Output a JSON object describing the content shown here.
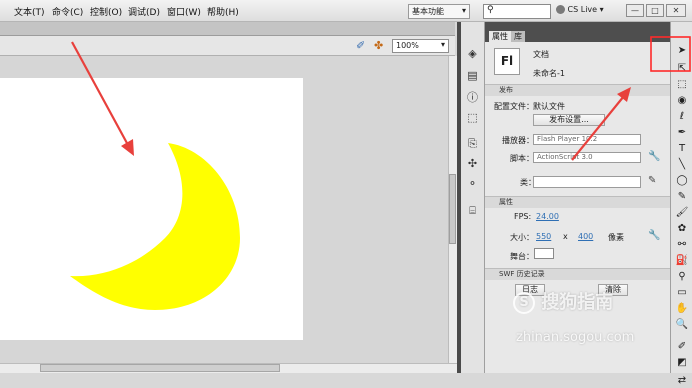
{
  "menu": [
    "文本(T)",
    "命令(C)",
    "控制(O)",
    "调试(D)",
    "窗口(W)",
    "帮助(H)"
  ],
  "workspace": "基本功能",
  "cs_live": "CS Live",
  "window_buttons": [
    "—",
    "□",
    "✕"
  ],
  "zoom": "100%",
  "panel_tabs": {
    "properties": "属性",
    "library": "库"
  },
  "document": {
    "badge": "Fl",
    "type_label": "文档",
    "name": "未命名-1"
  },
  "publish": {
    "section": "发布",
    "profile_label": "配置文件：",
    "profile_value": "默认文件",
    "settings_button": "发布设置...",
    "player_label": "播放器：",
    "player_value": "Flash Player 10.2",
    "script_label": "脚本：",
    "script_value": "ActionScript 3.0",
    "class_label": "类："
  },
  "attributes": {
    "section": "属性",
    "fps_label": "FPS:",
    "fps_value": "24.00",
    "size_label": "大小：",
    "width": "550",
    "x": "x",
    "height": "400",
    "unit": "像素",
    "stage_label": "舞台："
  },
  "swf_history": {
    "section": "SWF 历史记录",
    "btn_log": "日志",
    "btn_clear": "清除"
  },
  "watermark": {
    "brand": "搜狗指南",
    "url": "zhinan.sogou.com"
  },
  "colors": {
    "moon": "#ffff00",
    "arrow": "#e8403c",
    "highlight": "#ff2a2a"
  }
}
